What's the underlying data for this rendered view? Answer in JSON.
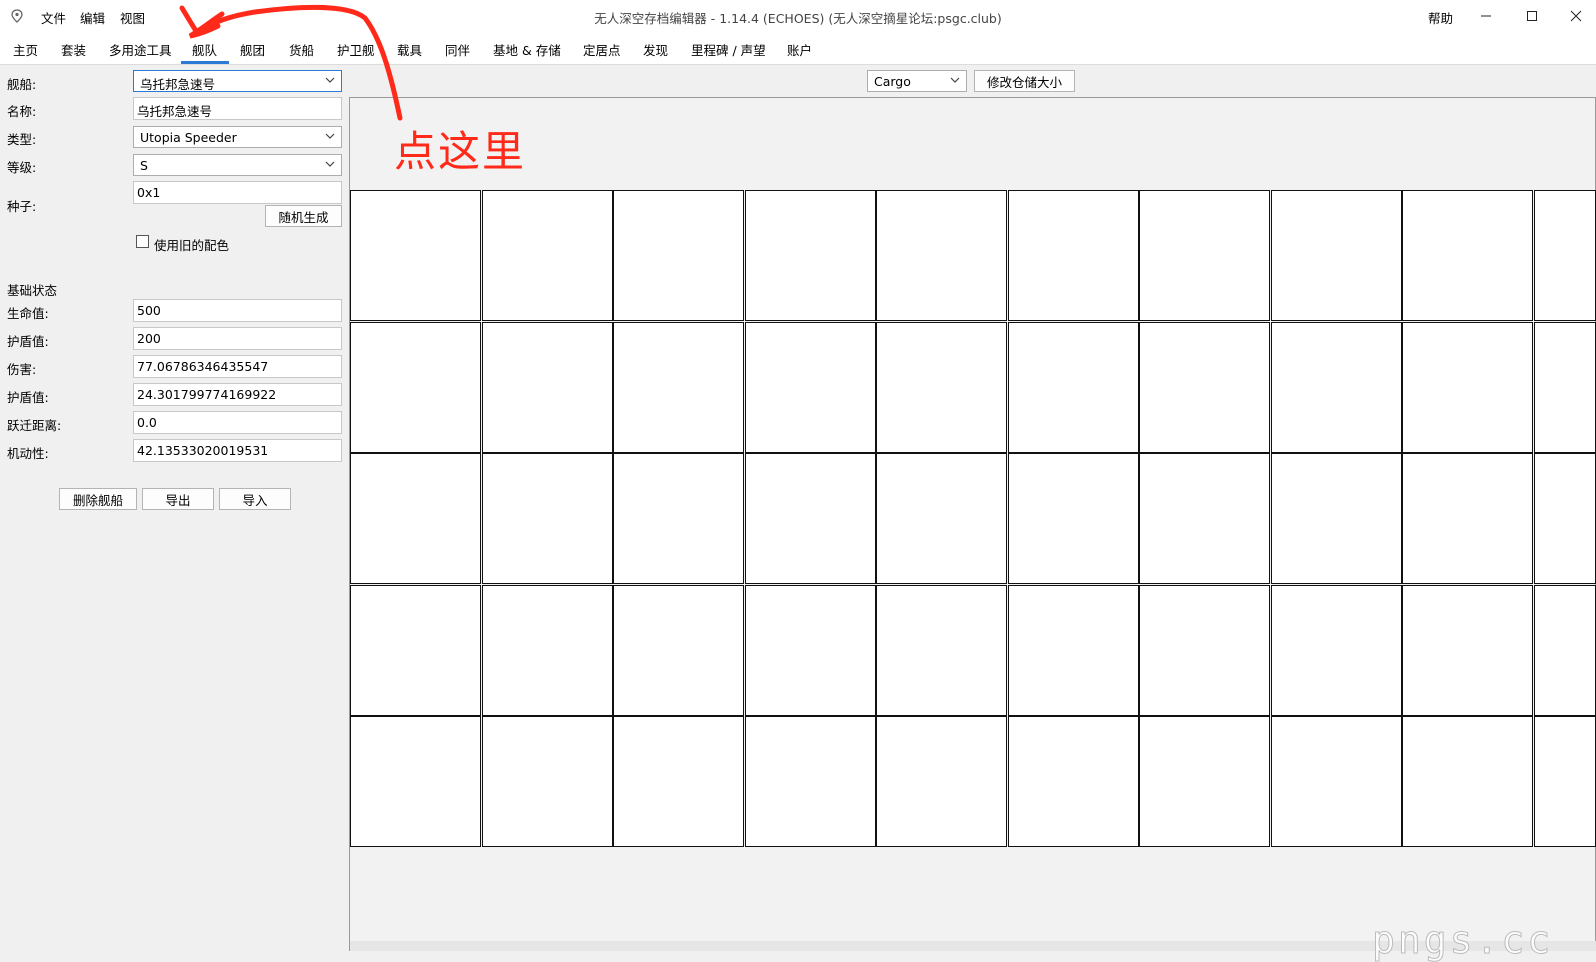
{
  "window": {
    "title": "无人深空存档编辑器 - 1.14.4 (ECHOES) (无人深空摘星论坛:psgc.club)",
    "menus": [
      "文件",
      "编辑",
      "视图"
    ],
    "help": "帮助",
    "controls": {
      "minimize": "—",
      "maximize": "☐",
      "close": "✕"
    }
  },
  "tabs": [
    "主页",
    "套装",
    "多用途工具",
    "舰队",
    "舰团",
    "货船",
    "护卫舰",
    "载具",
    "同伴",
    "基地 & 存储",
    "定居点",
    "发现",
    "里程碑 / 声望",
    "账户"
  ],
  "active_tab": "舰队",
  "ship_form": {
    "ship_label": "舰船:",
    "ship_value": "乌托邦急速号",
    "name_label": "名称:",
    "name_value": "乌托邦急速号",
    "type_label": "类型:",
    "type_value": "Utopia Speeder",
    "class_label": "等级:",
    "class_value": "S",
    "seed_label": "种子:",
    "seed_value": "0x1",
    "random_button": "随机生成",
    "old_colors_label": "使用旧的配色"
  },
  "base_stats": {
    "heading": "基础状态",
    "rows": [
      {
        "label": "生命值:",
        "value": "500"
      },
      {
        "label": "护盾值:",
        "value": "200"
      },
      {
        "label": "伤害:",
        "value": "77.06786346435547"
      },
      {
        "label": "护盾值:",
        "value": "24.301799774169922"
      },
      {
        "label": "跃迁距离:",
        "value": "0.0"
      },
      {
        "label": "机动性:",
        "value": "42.13533020019531"
      }
    ]
  },
  "actions": {
    "delete": "删除舰船",
    "export": "导出",
    "import": "导入"
  },
  "inventory": {
    "selected": "Cargo",
    "resize_button": "修改仓储大小",
    "rows": 5,
    "cols": 10
  },
  "annotation": "点这里",
  "watermark": "pngs.cc",
  "colors": {
    "accent": "#2b7bd6",
    "annotation": "#ff2a1a"
  },
  "icons": {
    "app": "map-pin-icon",
    "chevron": "chevron-down-icon"
  }
}
